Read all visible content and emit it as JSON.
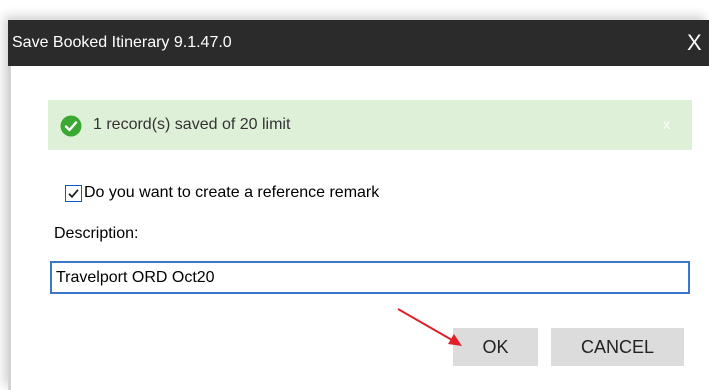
{
  "window": {
    "title": "Save Booked Itinerary 9.1.47.0",
    "close_glyph": "X"
  },
  "alert": {
    "message": "1 record(s) saved of 20 limit",
    "dismiss_glyph": "x",
    "icon": "check-circle-icon",
    "color": "#dff0d8",
    "icon_color": "#3aa832"
  },
  "reference_remark": {
    "label": "Do you want to create a reference remark",
    "checked": true
  },
  "description": {
    "label": "Description:",
    "value": "Travelport ORD Oct20"
  },
  "buttons": {
    "ok": "OK",
    "cancel": "CANCEL"
  },
  "annotation": {
    "arrow_color": "#e0202a"
  }
}
